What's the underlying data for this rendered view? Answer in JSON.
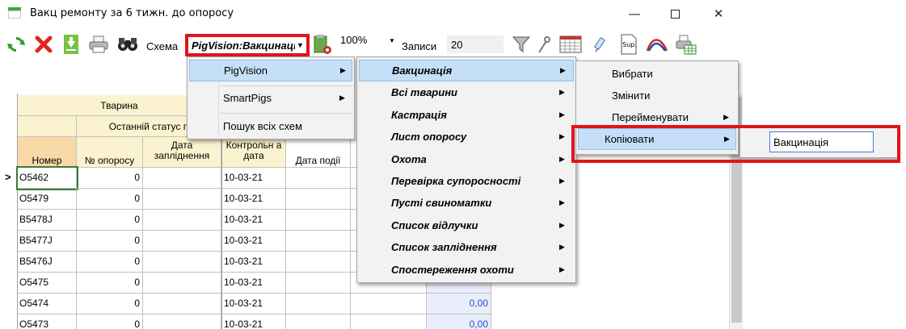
{
  "window": {
    "title": "Вакц ремонту за 6 тижн. до опоросу",
    "minimize": "—",
    "close": "✕"
  },
  "toolbar": {
    "scheme_label": "Схема",
    "scheme_value": "PigVision:Вакцинація",
    "zoom_value": "100%",
    "records_label": "Записи",
    "records_value": "20"
  },
  "grid": {
    "group_header": "Тварина",
    "subgroup_header": "Останній статус п",
    "columns": [
      "Номер",
      "№ опоросу",
      "Дата запліднення",
      "Контрольн а дата",
      "Дата події"
    ],
    "rows": [
      {
        "number": "O5462",
        "farrowing": "0",
        "control_date": "10-03-21",
        "value": ""
      },
      {
        "number": "O5479",
        "farrowing": "0",
        "control_date": "10-03-21",
        "value": ""
      },
      {
        "number": "B5478J",
        "farrowing": "0",
        "control_date": "10-03-21",
        "value": ""
      },
      {
        "number": "B5477J",
        "farrowing": "0",
        "control_date": "10-03-21",
        "value": ""
      },
      {
        "number": "B5476J",
        "farrowing": "0",
        "control_date": "10-03-21",
        "value": ""
      },
      {
        "number": "O5475",
        "farrowing": "0",
        "control_date": "10-03-21",
        "value": ""
      },
      {
        "number": "O5474",
        "farrowing": "0",
        "control_date": "10-03-21",
        "value": "0,00"
      },
      {
        "number": "O5473",
        "farrowing": "0",
        "control_date": "10-03-21",
        "value": "0,00"
      }
    ],
    "current_row_marker": ">"
  },
  "menu_level1": {
    "items": [
      "PigVision",
      "SmartPigs",
      "Пошук всіх схем"
    ],
    "highlighted": "PigVision"
  },
  "menu_level2": {
    "items": [
      "Вакцинація",
      "Всі тварини",
      "Кастрація",
      "Лист опоросу",
      "Охота",
      "Перевірка супоросності",
      "Пусті свиноматки",
      "Список відлучки",
      "Список запліднення",
      "Спостереження охоти"
    ],
    "highlighted": "Вакцинація"
  },
  "menu_level3": {
    "items": [
      "Вибрати",
      "Змінити",
      "Перейменувати",
      "Копіювати"
    ],
    "highlighted": "Копіювати"
  },
  "copy_menu": {
    "value": "Вакцинація"
  },
  "colors": {
    "highlight_box": "#e2141c",
    "menu_hover": "#c5dff8",
    "grid_header_yellow": "#fbf3cf",
    "grid_header_orange": "#fad9a8"
  }
}
